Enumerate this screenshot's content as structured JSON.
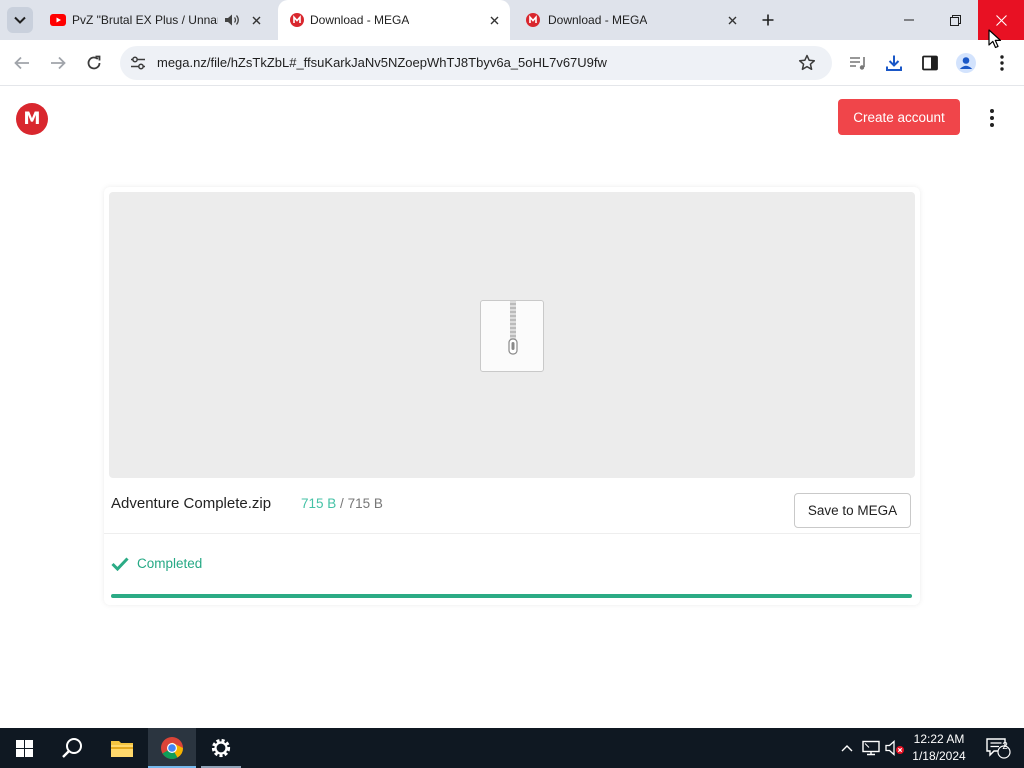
{
  "browser": {
    "tabs": [
      {
        "title": "PvZ \"Brutal EX Plus / Unnam",
        "favicon": "youtube-icon",
        "audio": true,
        "active": false
      },
      {
        "title": "Download - MEGA",
        "favicon": "mega-icon",
        "active": true
      },
      {
        "title": "Download - MEGA",
        "favicon": "mega-icon",
        "active": false
      }
    ],
    "url": "mega.nz/file/hZsTkZbL#_ffsuKarkJaNv5NZoepWhTJ8Tbyv6a_5oHL7v67U9fw",
    "colors": {
      "tabstrip": "#dfe3eb",
      "omnibox": "#eef1f6",
      "close_hover": "#e81123"
    }
  },
  "mega": {
    "logo_letter": "M",
    "create_account_label": "Create account",
    "file": {
      "name": "Adventure Complete.zip",
      "downloaded": "715 B",
      "separator": "/",
      "total": "715 B",
      "icon": "zip-file-icon"
    },
    "save_label": "Save to MEGA",
    "status": "Completed",
    "progress": 1.0,
    "colors": {
      "brand": "#d9272e",
      "button": "#f0454a",
      "success": "#2bab85"
    }
  },
  "taskbar": {
    "time": "12:22 AM",
    "date": "1/18/2024",
    "notification_count": "2"
  }
}
